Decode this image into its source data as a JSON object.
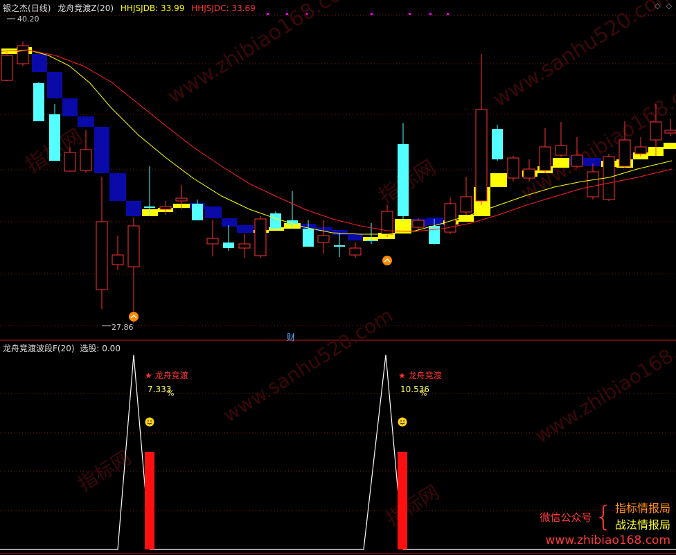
{
  "header": {
    "stock_name": "银之杰",
    "period": "(日线)",
    "indicator": "龙舟竞渡Z(20)",
    "hhjsjdb_label": "HHJSJDB: 33.99",
    "hhjsjdc_label": "HHJSJDC: 33.69"
  },
  "corner_icons": [
    "diamond-icon",
    "diamond-icon"
  ],
  "price_labels": {
    "high": "40.20",
    "low": "27.86",
    "cai": "财"
  },
  "sub_header": {
    "title": "龙舟竞渡波段F(20)",
    "select": "选股: 0.00"
  },
  "signals": [
    {
      "name": "★ 龙舟竞渡",
      "value": "7.333",
      "unit": "%"
    },
    {
      "name": "★ 龙舟竞渡",
      "value": "10.536",
      "unit": "%"
    }
  ],
  "promo": {
    "wechat": "微信公众号",
    "line1": "指标情报局",
    "line2": "战法情报局",
    "url": "www.zhibiao168.com"
  },
  "watermarks": [
    "www.zhibiao168.com",
    "www.sanhu520.com",
    "指标网"
  ],
  "colors": {
    "up": "#ff3333",
    "down": "#54ffff",
    "ma_yellow": "#ffff00",
    "ma_red": "#ff2020",
    "band_up": "#ffff00",
    "band_down": "#0a0aa8",
    "accent_magenta": "#ff00ff"
  }
}
